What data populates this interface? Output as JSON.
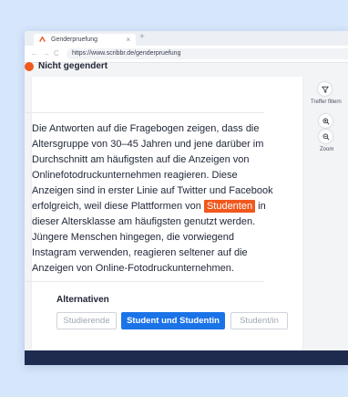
{
  "browser": {
    "tab_title": "Genderpruefung",
    "tab_close": "×",
    "new_tab": "+",
    "url": "https://www.scribbr.de/genderpruefung",
    "nav_back": "←",
    "nav_forward": "→",
    "nav_reload": "C"
  },
  "panel": {
    "status_title": "Nicht gegendert",
    "status_color": "#f0581d",
    "paragraph_before": "Die Antworten auf die Fragebogen zeigen, dass die Altersgruppe von 30–45 Jahren und jene darüber im Durchschnitt am häufigsten auf die Anzeigen von Onlinefotodruckunternehmen reagieren. Diese Anzeigen sind in erster Linie auf Twitter und Facebook erfolgreich, weil diese Plattformen von ",
    "highlighted_word": "Studenten",
    "paragraph_after": " in dieser Altersklasse am häufigsten genutzt werden. Jüngere Menschen hingegen, die vorwiegend Instagram verwenden, reagieren seltener auf die Anzeigen von Online-Fotodruckunternehmen.",
    "alternatives_label": "Alternativen",
    "alternatives": [
      "Studierende",
      "Student und Studentin",
      "Student/in"
    ],
    "selected_alternative": "Student und Studentin",
    "accent_color": "#1b73e8"
  },
  "sidebar": {
    "filter_label": "Treffer filtern",
    "zoom_label": "Zoom"
  }
}
